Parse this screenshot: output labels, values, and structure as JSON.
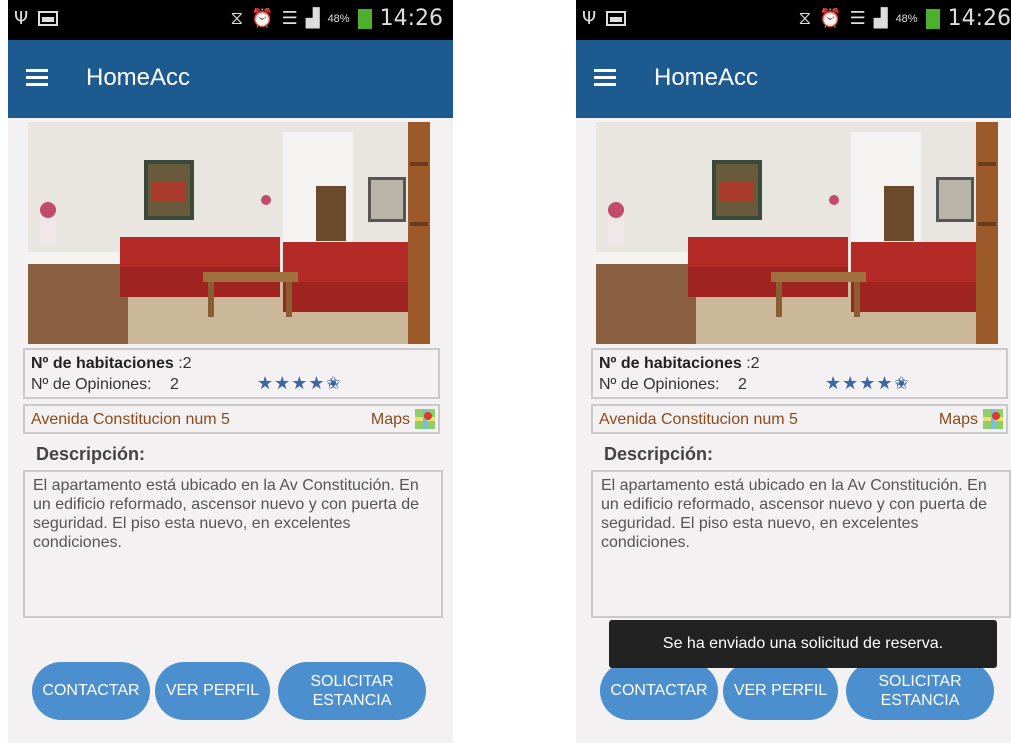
{
  "colors": {
    "appbar": "#1c5a8f",
    "button": "#4c8fcf",
    "link": "#8b4a1b",
    "stars": "#3e66a4"
  },
  "status_bar": {
    "time": "14:26",
    "battery_percent": "48%"
  },
  "app": {
    "title": "HomeAcc"
  },
  "listing": {
    "rooms_label": "Nº de habitaciones",
    "rooms_value": ":2",
    "reviews_label": "Nº de Opiniones:",
    "reviews_value": "2",
    "rating": 4.5,
    "address": "Avenida Constitucion num 5",
    "maps_label": "Maps",
    "description_title": "Descripción:",
    "description": "El apartamento está ubicado en la Av Constitución. En un edificio reformado, ascensor nuevo y con puerta de seguridad. El piso esta nuevo, en excelentes condiciones."
  },
  "actions": {
    "contact": "CONTACTAR",
    "view_profile": "VER PERFIL",
    "request_line1": "SOLICITAR",
    "request_line2": "ESTANCIA"
  },
  "toast": {
    "message": "Se ha enviado una solicitud de reserva."
  }
}
